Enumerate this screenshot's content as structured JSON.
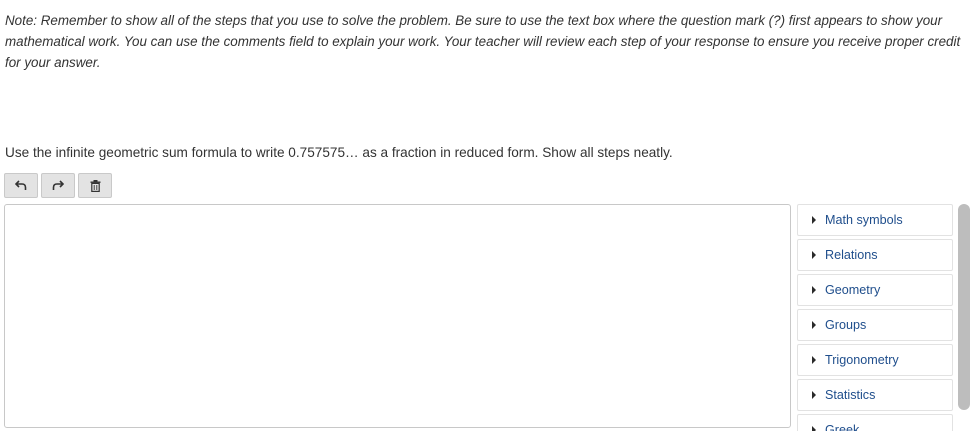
{
  "instructions": {
    "note": "Note: Remember to show all of the steps that you use to solve the problem. Be sure to use the text box where the question mark (?) first appears to show your mathematical work. You can use the comments field to explain your work. Your teacher will review each step of your response to ensure you receive proper credit for your answer."
  },
  "question": {
    "prompt": "Use the infinite geometric sum formula to write 0.757575… as a fraction in reduced form. Show all steps neatly."
  },
  "toolbar": {
    "buttons": [
      {
        "icon": "undo-icon"
      },
      {
        "icon": "redo-icon"
      },
      {
        "icon": "trash-icon"
      }
    ]
  },
  "editor": {
    "value": ""
  },
  "palette": {
    "items": [
      {
        "label": "Math symbols"
      },
      {
        "label": "Relations"
      },
      {
        "label": "Geometry"
      },
      {
        "label": "Groups"
      },
      {
        "label": "Trigonometry"
      },
      {
        "label": "Statistics"
      },
      {
        "label": "Greek"
      }
    ]
  },
  "colors": {
    "text": "#333333",
    "link": "#1f4e8c",
    "button_bg": "#e3e3e3",
    "scrollbar": "#bdbdbd"
  }
}
